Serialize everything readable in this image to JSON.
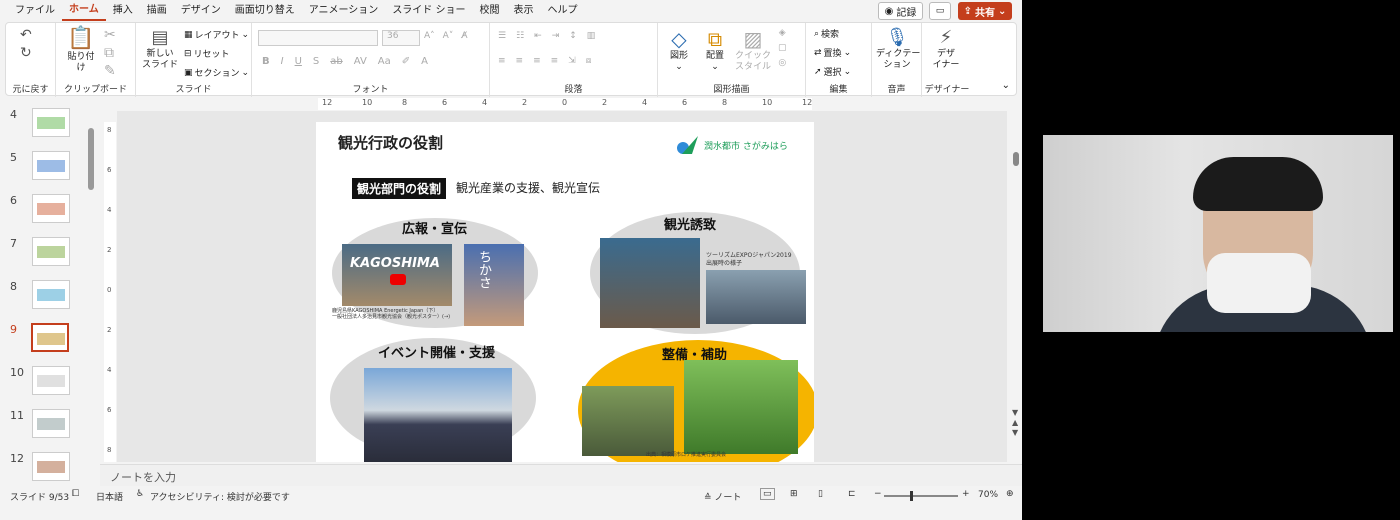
{
  "menu": {
    "items": [
      "ファイル",
      "ホーム",
      "挿入",
      "描画",
      "デザイン",
      "画面切り替え",
      "アニメーション",
      "スライド ショー",
      "校閲",
      "表示",
      "ヘルプ"
    ],
    "active_index": 1
  },
  "top_right": {
    "record": "記録",
    "share": "共有"
  },
  "ribbon": {
    "undo_group": "元に戻す",
    "clipboard": {
      "label": "クリップボード",
      "paste": "貼り付け"
    },
    "slides": {
      "label": "スライド",
      "new_slide": "新しい\nスライド",
      "layout": "レイアウト",
      "reset": "リセット",
      "section": "セクション"
    },
    "font": {
      "label": "フォント",
      "size": "36"
    },
    "paragraph": {
      "label": "段落"
    },
    "drawing": {
      "label": "図形描画",
      "shape": "図形",
      "arrange": "配置",
      "quick_style": "クイック\nスタイル"
    },
    "editing": {
      "label": "編集",
      "find": "検索",
      "replace": "置換",
      "select": "選択"
    },
    "voice": {
      "label": "音声",
      "dictate": "ディクテー\nション"
    },
    "designer": {
      "label": "デザイナー",
      "design": "デザ\nイナー"
    }
  },
  "thumbnails": {
    "numbers": [
      "4",
      "5",
      "6",
      "7",
      "8",
      "9",
      "10",
      "11",
      "12"
    ],
    "selected": "9"
  },
  "ruler": {
    "h": [
      "12",
      "10",
      "8",
      "6",
      "4",
      "2",
      "0",
      "2",
      "4",
      "6",
      "8",
      "10",
      "12"
    ],
    "v": [
      "8",
      "6",
      "4",
      "2",
      "0",
      "2",
      "4",
      "6",
      "8"
    ]
  },
  "slide": {
    "title": "観光行政の役割",
    "logo_text": "潤水都市 さがみはら",
    "dept_label": "観光部門の役割",
    "dept_desc": "観光産業の支援、観光宣伝",
    "sections": {
      "pr": "広報・宣伝",
      "attract": "観光誘致",
      "event": "イベント開催・支援",
      "infra": "整備・補助"
    },
    "kagoshima": "KAGOSHIMA",
    "pr_caption": "鹿児島県KAGOSHIMA Energetic Japan（下）\n一般社団法人多治見市観光協会（観光ポスター）(→)",
    "expo_caption": "ツーリズムEXPOジャパン2019\n出展時の様子",
    "infra_caption": "出典：相模原市ロケ推進実行委員会",
    "poster_text": "ちかさ"
  },
  "notes_placeholder": "ノートを入力",
  "status": {
    "slide": "スライド 9/53",
    "lang": "日本語",
    "accessibility": "アクセシビリティ: 検討が必要です",
    "notes": "ノート",
    "zoom": "70%"
  },
  "colors": {
    "accent": "#c43e1c",
    "slide_yellow": "#f5b400",
    "logo_green": "#1e9e5a"
  }
}
